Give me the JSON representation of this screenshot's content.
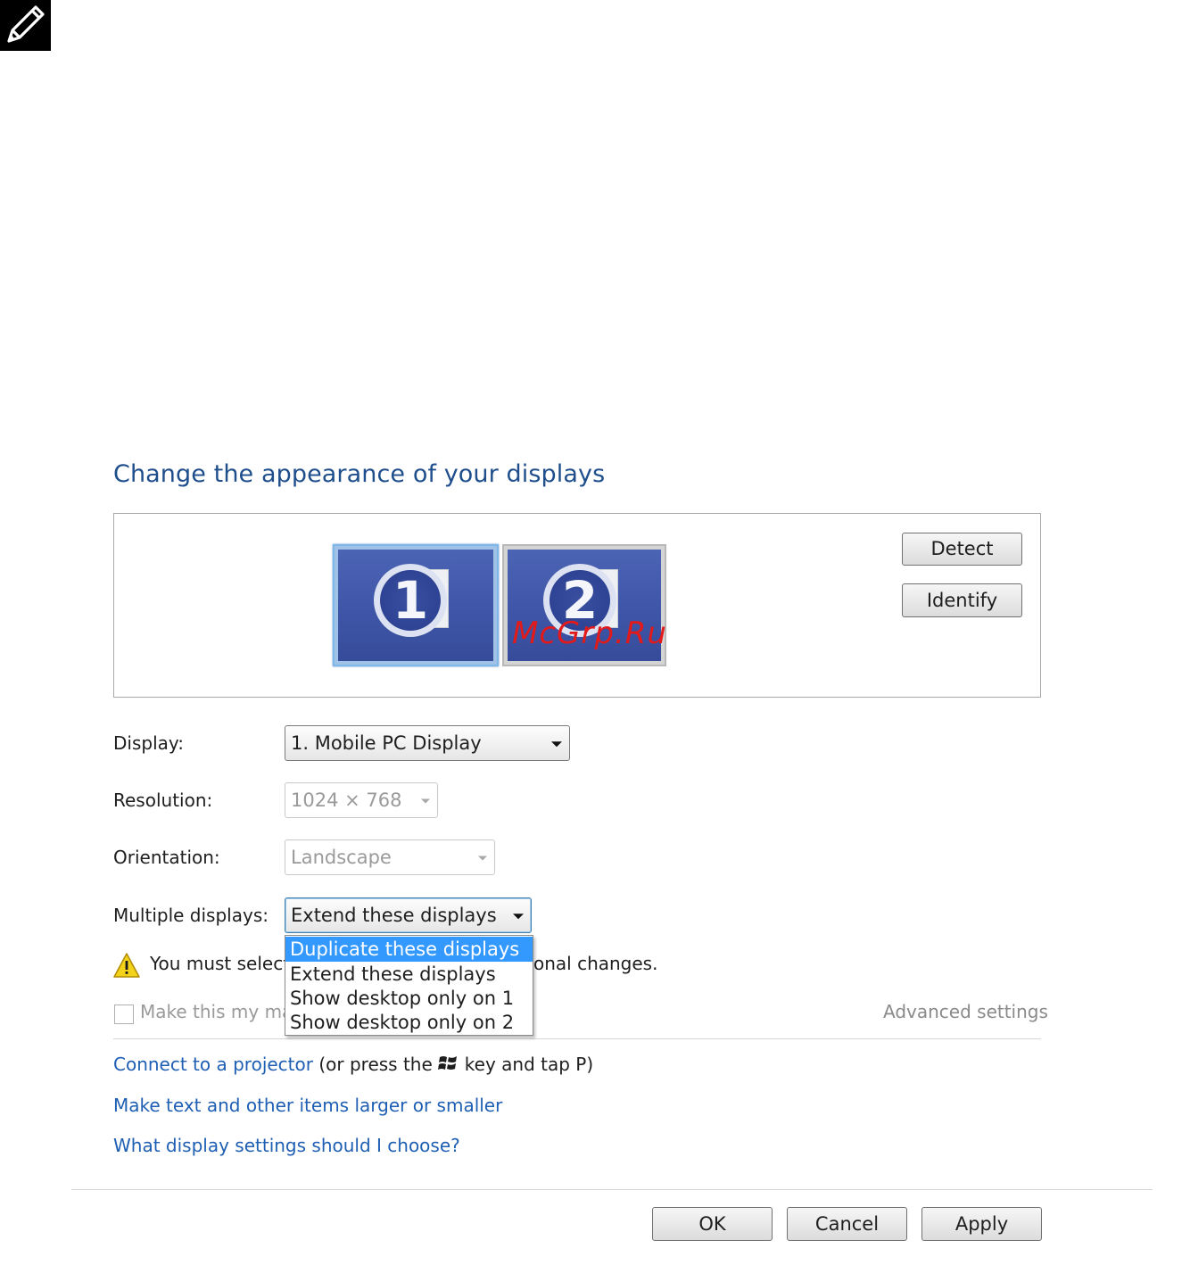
{
  "title": "Change the appearance of your displays",
  "preview": {
    "monitors": [
      {
        "number": "1",
        "selected": true
      },
      {
        "number": "2",
        "selected": false
      }
    ],
    "detect_label": "Detect",
    "identify_label": "Identify"
  },
  "watermark": "McGrp.Ru",
  "fields": {
    "display_label": "Display:",
    "display_value": "1. Mobile PC Display",
    "resolution_label": "Resolution:",
    "resolution_value": "1024 × 768",
    "orientation_label": "Orientation:",
    "orientation_value": "Landscape",
    "multiple_label": "Multiple displays:",
    "multiple_value": "Extend these displays"
  },
  "dropdown": {
    "options": [
      "Duplicate these displays",
      "Extend these displays",
      "Show desktop only on 1",
      "Show desktop only on 2"
    ],
    "highlighted_index": 0
  },
  "warning": {
    "text_visible_left": "You must select",
    "text_visible_right": "onal changes."
  },
  "checkbox": {
    "label_visible": "Make this my ma",
    "checked": false
  },
  "advanced_settings": "Advanced settings",
  "links": {
    "projector_link": "Connect to a projector",
    "projector_text_before": "(or press the",
    "projector_text_after": "key and tap P)",
    "text_size_link": "Make text and other items larger or smaller",
    "help_link": "What display settings should I choose?"
  },
  "buttons": {
    "ok": "OK",
    "cancel": "Cancel",
    "apply": "Apply"
  },
  "icons": {
    "note": "note-pencil-icon",
    "warning": "warning-icon",
    "windows": "windows-logo-icon"
  },
  "colors": {
    "title": "#1f4e8c",
    "link": "#1e5fb3",
    "highlight": "#3399ff",
    "watermark": "#e21a1a"
  }
}
